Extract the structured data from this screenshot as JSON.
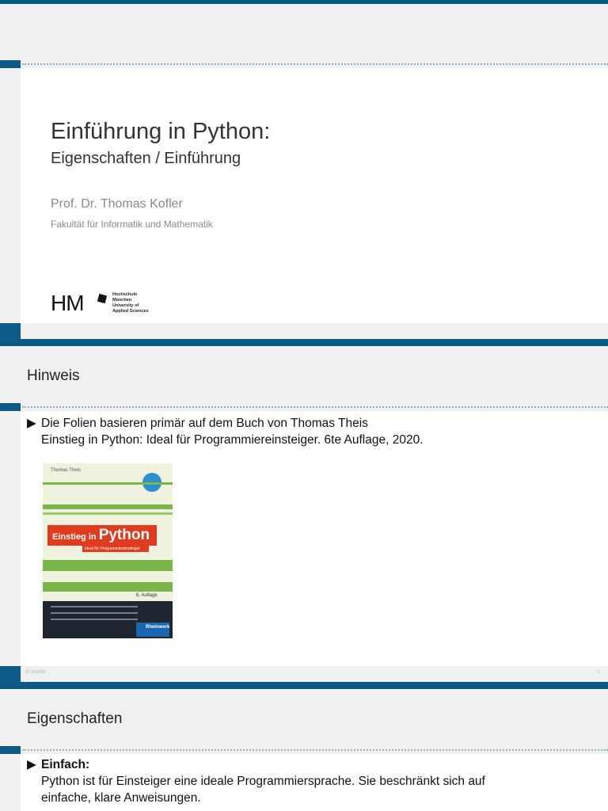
{
  "slide1": {
    "title": "Einführung in Python:",
    "subtitle": "Eigenschaften / Einführung",
    "author": "Prof. Dr. Thomas Kofler",
    "faculty": "Fakultät für Informatik und Mathematik",
    "logo_letters": "HM",
    "logo_text": [
      "Hochschule",
      "München",
      "University of",
      "Applied Sciences"
    ]
  },
  "slide2": {
    "heading": "Hinweis",
    "bullet_arrow": "▶",
    "bullet_line1": "Die Folien basieren primär auf dem Buch von Thomas Theis",
    "bullet_line2": "Einstieg in Python: Ideal für Programmiereinsteiger. 6te Auflage, 2020.",
    "book": {
      "author": "Thomas Theis",
      "title_small": "Einstieg in",
      "title_big": "Python",
      "subtitle": "Ideal für Programmiereinsteiger",
      "edition": "6. Auflage",
      "publisher": "Rheinwerk"
    },
    "footer_date": "07.10.2024",
    "footer_page": "2"
  },
  "slide3": {
    "heading": "Eigenschaften",
    "bullet_arrow": "▶",
    "bullet_title": "Einfach:",
    "bullet_line1": "Python ist für Einsteiger eine ideale Programmiersprache. Sie beschränkt sich auf",
    "bullet_line2": "einfache, klare Anweisungen."
  },
  "colors": {
    "accent": "#0e5a86",
    "book_red": "#e03a1f"
  }
}
